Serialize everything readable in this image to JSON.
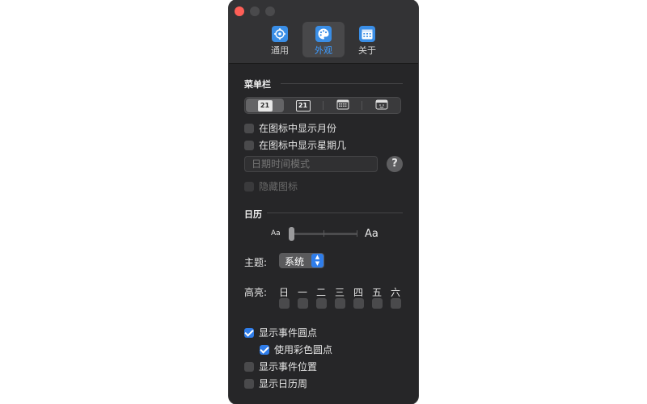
{
  "toolbar": {
    "tabs": [
      {
        "label": "通用",
        "icon": "gear-icon",
        "selected": false
      },
      {
        "label": "外观",
        "icon": "palette-icon",
        "selected": true
      },
      {
        "label": "关于",
        "icon": "calendar-icon",
        "selected": false
      }
    ]
  },
  "menubar": {
    "title": "菜单栏",
    "styles": [
      {
        "text": "21",
        "icon": "calendar-number-filled-icon",
        "selected": true
      },
      {
        "text": "21",
        "icon": "calendar-number-outline-icon",
        "selected": false
      },
      {
        "text": "",
        "icon": "calendar-grid-icon",
        "selected": false
      },
      {
        "text": "",
        "icon": "calendar-face-icon",
        "selected": false
      }
    ],
    "show_month": {
      "label": "在图标中显示月份",
      "checked": false
    },
    "show_weekday": {
      "label": "在图标中显示星期几",
      "checked": false
    },
    "datetime_pattern": {
      "placeholder": "日期时间模式",
      "value": ""
    },
    "help_label": "?",
    "hide_icon": {
      "label": "隐藏图标",
      "checked": false,
      "enabled": false
    }
  },
  "calendar": {
    "title": "日历",
    "size_small": "Aa",
    "size_large": "Aa",
    "size_level": 0,
    "theme_label": "主题:",
    "theme_value": "系统",
    "highlight_label": "高亮:",
    "weekdays": [
      "日",
      "一",
      "二",
      "三",
      "四",
      "五",
      "六"
    ],
    "show_event_dots": {
      "label": "显示事件圆点",
      "checked": true
    },
    "use_colored_dots": {
      "label": "使用彩色圆点",
      "checked": true
    },
    "show_event_location": {
      "label": "显示事件位置",
      "checked": false
    },
    "show_calendar_weeks": {
      "label": "显示日历周",
      "checked": false
    }
  },
  "colors": {
    "accent": "#2f7dea",
    "close": "#fe5f57",
    "window_bg": "#262628"
  }
}
